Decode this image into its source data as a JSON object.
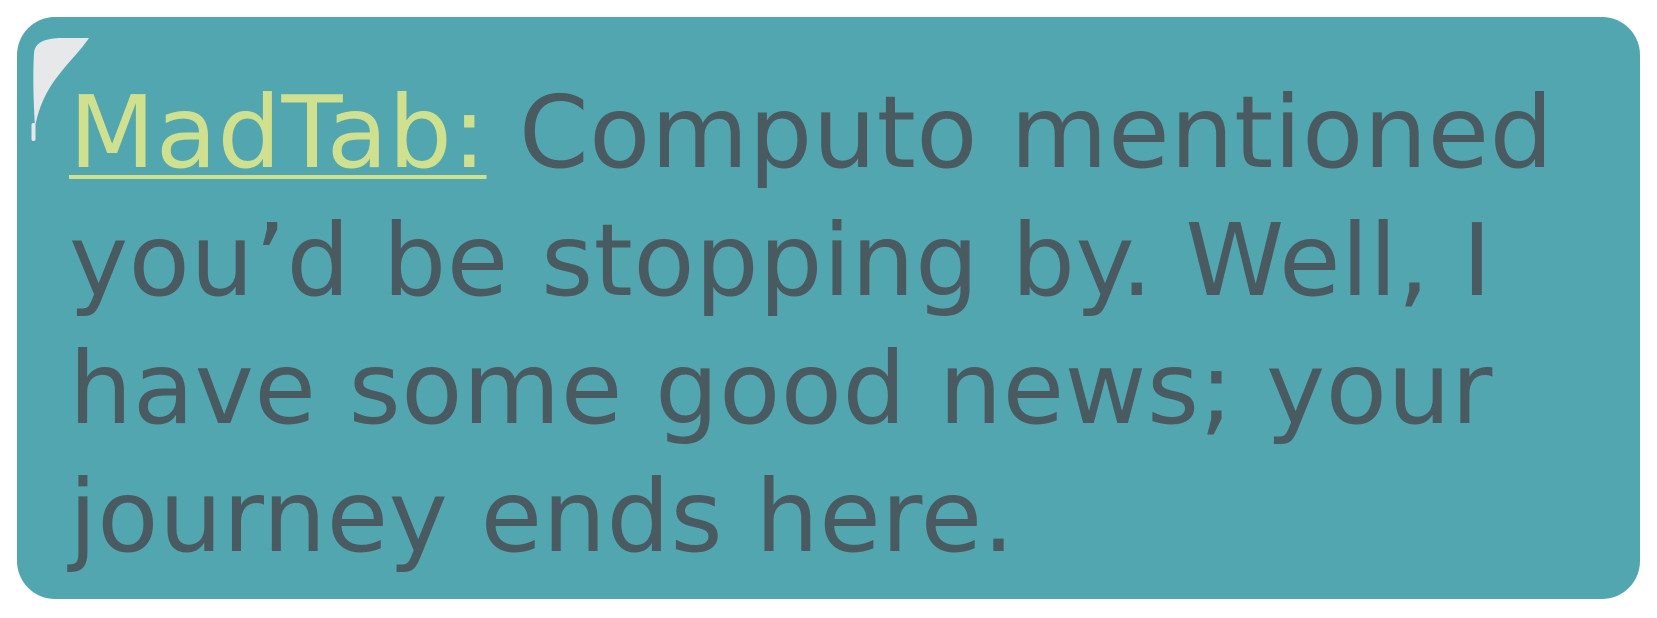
{
  "dialog": {
    "speaker": "MadTab:",
    "message": "Computo mentioned you’d be stopping by. Well, I have some good news; your journey ends here."
  },
  "colors": {
    "box_background": "#52a6af",
    "speaker_text": "#cfe08e",
    "message_text": "#4a5a61",
    "gloss": "#e6e8ea"
  },
  "icons": {
    "corner": "gloss-highlight-icon"
  }
}
